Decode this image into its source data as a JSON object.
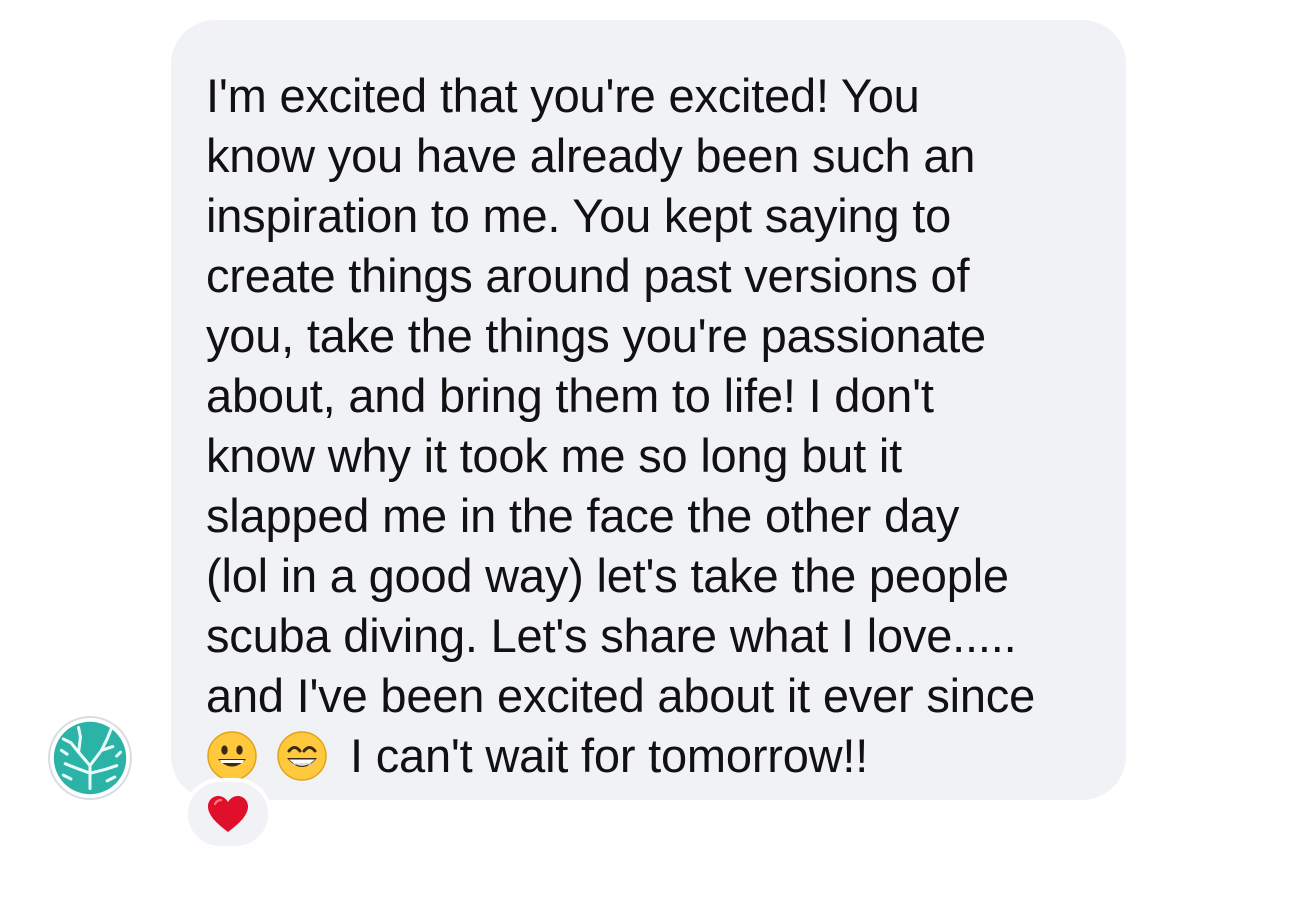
{
  "message": {
    "lines": [
      "I'm excited that you're excited! You",
      "know you have already been such an",
      "inspiration to me. You kept saying to",
      "create things around past versions of",
      "you, take the things you're passionate",
      "about, and bring them to life! I don't",
      "know why it took me so long but it",
      "slapped me in the face the other day",
      "(lol in a good way) let's take the people",
      "scuba diving. Let's share what I love.....",
      "and I've been excited about it ever since"
    ],
    "final_text": "I can't wait for tomorrow!!",
    "emojis": [
      "grinning-face",
      "beaming-face-with-smiling-eyes"
    ]
  },
  "reaction": {
    "emoji": "red-heart"
  },
  "avatar": {
    "icon": "coral-icon",
    "color": "#2bb3a8"
  },
  "colors": {
    "bubble": "#f1f2f5",
    "text": "#111111",
    "heart": "#e0102a",
    "emoji_yellow": "#ffc83d"
  }
}
